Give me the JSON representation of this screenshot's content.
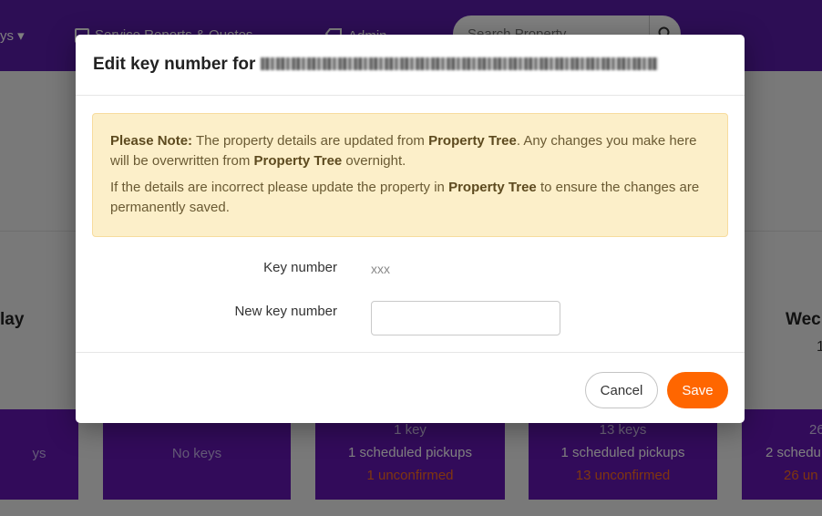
{
  "topbar": {
    "keys_menu": "ys",
    "reports_menu": "Service Reports & Quotes",
    "admin_menu": "Admin",
    "search": {
      "placeholder": "Search Property"
    }
  },
  "background": {
    "day_left": "lay",
    "day_right": "Wec",
    "day_right_num": "1",
    "cards": [
      {
        "keys": "ys",
        "pickups": "",
        "unconfirmed": ""
      },
      {
        "keys": "No keys",
        "pickups": "",
        "unconfirmed": ""
      },
      {
        "keys": "1 key",
        "pickups": "1 scheduled pickups",
        "unconfirmed": "1 unconfirmed"
      },
      {
        "keys": "13 keys",
        "pickups": "1 scheduled pickups",
        "unconfirmed": "13 unconfirmed"
      },
      {
        "keys": "26",
        "pickups": "2 schedu",
        "unconfirmed": "26 un"
      }
    ]
  },
  "modal": {
    "title": "Edit key number for",
    "notice": {
      "note_label": "Please Note:",
      "line1_a": " The property details are updated from ",
      "brand": "Property Tree",
      "line1_b": ". Any changes you make here will be overwritten from ",
      "line1_c": " overnight.",
      "line2_a": "If the details are incorrect please update the property in ",
      "line2_b": " to ensure the changes are permanently saved."
    },
    "key_number_label": "Key number",
    "key_number_value": "xxx",
    "new_key_label": "New key number",
    "new_key_value": "",
    "cancel_label": "Cancel",
    "save_label": "Save"
  },
  "colors": {
    "brand_purple": "#5b1cab",
    "accent_orange": "#ff6600",
    "notice_bg": "#fcefc9"
  }
}
